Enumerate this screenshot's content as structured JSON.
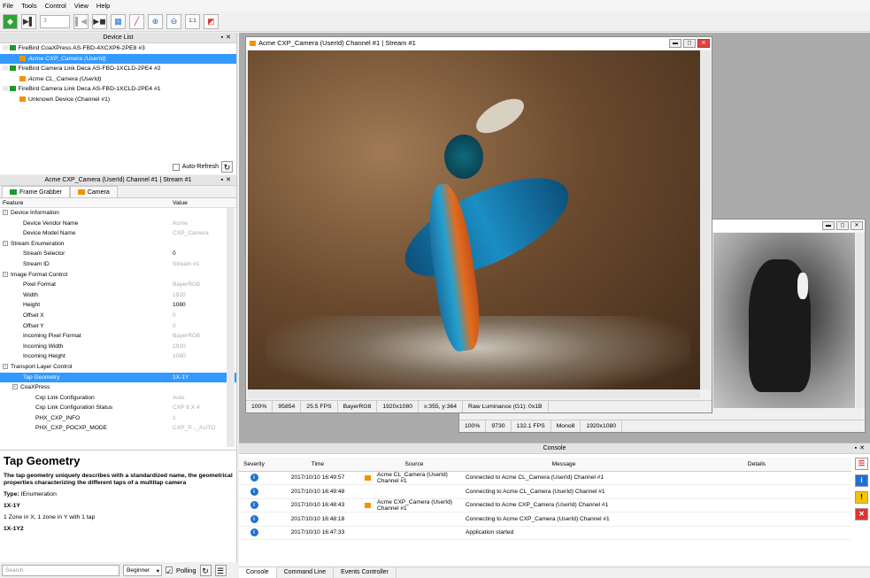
{
  "menu": [
    "File",
    "Tools",
    "Control",
    "View",
    "Help"
  ],
  "toolbar": {
    "frame_count": "3"
  },
  "device_list": {
    "title": "Device List",
    "items": [
      {
        "label": "FireBird CoaXPress AS-FBD-4XCXP6-2PE8 #3",
        "type": "board"
      },
      {
        "label": "Acme CXP_Camera (UserId)",
        "type": "camera",
        "selected": true
      },
      {
        "label": "FireBird Camera Link Deca AS-FBD-1XCLD-2PE4 #2",
        "type": "board"
      },
      {
        "label": "Acme CL_Camera (UserId)",
        "type": "camera"
      },
      {
        "label": "FireBird Camera Link Deca AS-FBD-1XCLD-2PE4 #1",
        "type": "board"
      },
      {
        "label": "Unknown Device (Channel #1)",
        "type": "unknown"
      }
    ],
    "auto_refresh": "Auto-Refresh"
  },
  "feature_panel": {
    "title": "Acme CXP_Camera (UserId) Channel #1 | Stream #1",
    "tabs": [
      "Frame Grabber",
      "Camera"
    ],
    "col_feature": "Feature",
    "col_value": "Value",
    "rows": [
      {
        "label": "Device Information",
        "value": "",
        "level": 0,
        "cat": true
      },
      {
        "label": "Device Vendor Name",
        "value": "Acme",
        "level": 1,
        "gray": true
      },
      {
        "label": "Device Model Name",
        "value": "CXP_Camera",
        "level": 1,
        "gray": true
      },
      {
        "label": "Stream Enumeration",
        "value": "",
        "level": 0,
        "cat": true
      },
      {
        "label": "Stream Selector",
        "value": "0",
        "level": 1
      },
      {
        "label": "Stream ID",
        "value": "Stream #1",
        "level": 1,
        "gray": true
      },
      {
        "label": "Image Format Control",
        "value": "",
        "level": 0,
        "cat": true
      },
      {
        "label": "Pixel Format",
        "value": "BayerRG8",
        "level": 1,
        "gray": true
      },
      {
        "label": "Width",
        "value": "1920",
        "level": 1,
        "gray": true
      },
      {
        "label": "Height",
        "value": "1080",
        "level": 1
      },
      {
        "label": "Offset X",
        "value": "0",
        "level": 1,
        "gray": true
      },
      {
        "label": "Offset Y",
        "value": "0",
        "level": 1,
        "gray": true
      },
      {
        "label": "Incoming Pixel Format",
        "value": "BayerRG8",
        "level": 1,
        "gray": true
      },
      {
        "label": "Incoming Width",
        "value": "1920",
        "level": 1,
        "gray": true
      },
      {
        "label": "Incoming Height",
        "value": "1080",
        "level": 1,
        "gray": true
      },
      {
        "label": "Transport Layer Control",
        "value": "",
        "level": 0,
        "cat": true
      },
      {
        "label": "Tap Geometry",
        "value": "1X-1Y",
        "level": 1,
        "selected": true
      },
      {
        "label": "CoaXPress",
        "value": "",
        "level": 1,
        "cat": true
      },
      {
        "label": "Cxp Link Configuration",
        "value": "Auto",
        "level": 2,
        "gray": true
      },
      {
        "label": "Cxp Link Configuration Status",
        "value": "CXP 6 X 4",
        "level": 2,
        "gray": true
      },
      {
        "label": "PHX_CXP_INFO",
        "value": "1",
        "level": 2,
        "gray": true
      },
      {
        "label": "PHX_CXP_POCXP_MODE",
        "value": "CXP_P..._AUTO",
        "level": 2,
        "gray": true
      }
    ]
  },
  "help": {
    "title": "Tap Geometry",
    "description": "The tap geometry uniquely describes with a standardized name, the geometrical properties characterizing the different taps of a multitap camera",
    "type_label": "Type:",
    "type_value": "IEnumeration",
    "entry1": "1X-1Y",
    "entry1_desc": "1 Zone in X, 1 zone in Y with 1 tap",
    "entry2": "1X-1Y2"
  },
  "bottom": {
    "search_placeholder": "Search",
    "level": "Beginner",
    "polling": "Polling"
  },
  "win1": {
    "title": "Acme CXP_Camera (UserId) Channel #1 | Stream #1",
    "status": [
      "100%",
      "95854",
      "25.5 FPS",
      "BayerRG8",
      "1920x1080",
      "x:355, y:364",
      "Raw Luminance (G1): 0x1B"
    ]
  },
  "win2": {
    "status": [
      "100%",
      "9730",
      "132.1 FPS",
      "Mono8",
      "1920x1080"
    ]
  },
  "console": {
    "title": "Console",
    "cols": [
      "Severity",
      "Time",
      "Source",
      "Message",
      "Details"
    ],
    "rows": [
      {
        "time": "2017/10/10 16:49:57",
        "source": "Acme CL_Camera (UserId) Channel #1",
        "message": "Connected to Acme CL_Camera (UserId) Channel #1",
        "icon": true
      },
      {
        "time": "2017/10/10 16:49:48",
        "source": "",
        "message": "Connecting to Acme CL_Camera (UserId) Channel #1",
        "icon": false
      },
      {
        "time": "2017/10/10 16:48:43",
        "source": "Acme CXP_Camera (UserId) Channel #1",
        "message": "Connected to Acme CXP_Camera (UserId) Channel #1",
        "icon": true
      },
      {
        "time": "2017/10/10 16:48:18",
        "source": "",
        "message": "Connecting to Acme CXP_Camera (UserId) Channel #1",
        "icon": false
      },
      {
        "time": "2017/10/10 16:47:33",
        "source": "",
        "message": "Application started",
        "icon": false
      }
    ],
    "tabs": [
      "Console",
      "Command Line",
      "Events Controller"
    ]
  }
}
